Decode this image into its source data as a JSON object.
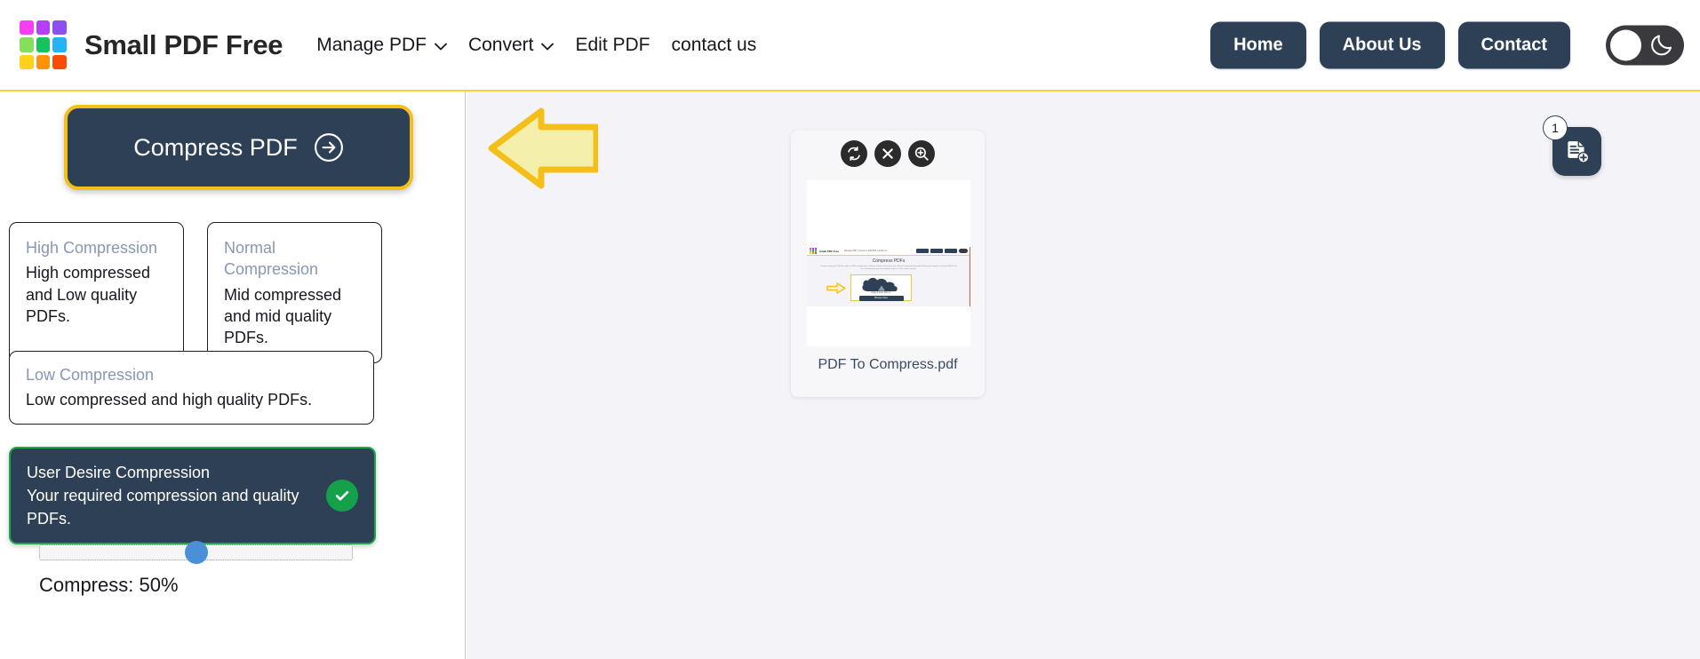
{
  "brand": {
    "name": "Small PDF Free",
    "logo_colors": [
      "#f63ff0",
      "#b43ff6",
      "#8c4ff4",
      "#84e05a",
      "#12c45c",
      "#21b4f8",
      "#ffd21a",
      "#ff9406",
      "#fb4c07"
    ]
  },
  "nav": {
    "items": [
      {
        "label": "Manage PDF",
        "icon": "chevron-down-icon",
        "has_chevron": true
      },
      {
        "label": "Convert",
        "icon": "chevron-down-icon",
        "has_chevron": true
      },
      {
        "label": "Edit PDF",
        "has_chevron": false
      },
      {
        "label": "contact us",
        "has_chevron": false
      }
    ],
    "buttons": [
      {
        "label": "Home"
      },
      {
        "label": "About Us"
      },
      {
        "label": "Contact"
      }
    ],
    "theme_toggle": {
      "icon": "moon-icon",
      "state": "light"
    }
  },
  "accent": {
    "yellow": "#f5bf1a",
    "dark": "#2e4055",
    "green": "#1ea84c",
    "slider_blue": "#4a90d9",
    "muted_blue": "#8797b4"
  },
  "left_panel": {
    "cta": {
      "label": "Compress PDF",
      "icon": "arrow-right-circle-icon"
    },
    "options": [
      {
        "title": "High Compression",
        "desc": "High compressed and Low quality PDFs.",
        "selected": false
      },
      {
        "title": "Normal Compression",
        "desc": "Mid compressed and mid quality PDFs.",
        "selected": false
      },
      {
        "title": "Low Compression",
        "desc": "Low compressed and high quality PDFs.",
        "selected": false
      },
      {
        "title": "User Desire Compression",
        "desc": "Your required compression and quality PDFs.",
        "selected": true
      }
    ],
    "slider": {
      "label": "Compress: 50%",
      "value": 50,
      "min": 0,
      "max": 100
    }
  },
  "right_panel": {
    "pointer_arrow": "left-pointing-arrow-annotation",
    "pdf_preview": {
      "filename": "PDF To Compress.pdf",
      "tools": [
        {
          "name": "rotate-icon",
          "label": "Rotate"
        },
        {
          "name": "close-icon",
          "label": "Remove"
        },
        {
          "name": "zoom-in-icon",
          "label": "Preview"
        }
      ],
      "thumbnail": {
        "site_brand": "Small PDF Free",
        "site_nav": "Manage PDF  •  Convert  •  Edit PDF  contact us",
        "page_title": "Compress PDFs",
        "page_sub": "Compressing your PDF files with our PDF compression software reduces document size without compromising quality. Make your image or scanned PDF fit for free to download, print and upload, and it is a free online service.",
        "drop_text": "drag & drop files or",
        "browse_label": "Browse Files",
        "nav_buttons": [
          "Home",
          "About Us",
          "Contact"
        ]
      }
    },
    "floating_upload": {
      "icon": "document-add-icon",
      "badge_count": "1"
    }
  }
}
